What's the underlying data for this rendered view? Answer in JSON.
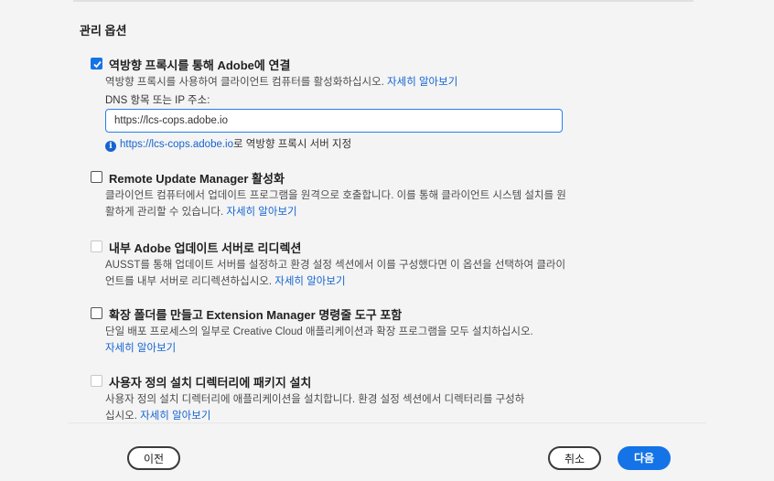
{
  "section_title": "관리 옵션",
  "options": [
    {
      "title": "역방향 프록시를 통해 Adobe에 연결",
      "checked": true,
      "disabled": false,
      "description": "역방향 프록시를 사용하여 클라이언트 컴퓨터를 활성화하십시오. ",
      "link": "자세히 알아보기"
    },
    {
      "title": "Remote Update Manager 활성화",
      "checked": false,
      "disabled": false,
      "description": "클라이언트 컴퓨터에서 업데이트 프로그램을 원격으로 호출합니다. 이를 통해 클라이언트 시스템 설치를 원활하게 관리할 수 있습니다. ",
      "link": "자세히 알아보기"
    },
    {
      "title": "내부 Adobe 업데이트 서버로 리디렉션",
      "checked": false,
      "disabled": true,
      "description": "AUSST를 통해 업데이트 서버를 설정하고 환경 설정 섹션에서 이를 구성했다면 이 옵션을 선택하여 클라이언트를 내부 서버로 리디렉션하십시오. ",
      "link": "자세히 알아보기"
    },
    {
      "title": "확장 폴더를 만들고 Extension Manager 명령줄 도구 포함",
      "checked": false,
      "disabled": false,
      "description": "단일 배포 프로세스의 일부로 Creative Cloud 애플리케이션과 확장 프로그램을 모두 설치하십시오.",
      "link": "자세히 알아보기"
    },
    {
      "title": "사용자 정의 설치 디렉터리에 패키지 설치",
      "checked": false,
      "disabled": true,
      "description": "사용자 정의 설치 디렉터리에 애플리케이션을 설치합니다. 환경 설정 섹션에서 디렉터리를 구성하십시오. ",
      "link": "자세히 알아보기"
    }
  ],
  "dns": {
    "label": "DNS 항목 또는 IP 주소:",
    "value": "https://lcs-cops.adobe.io",
    "info_link": "https://lcs-cops.adobe.io",
    "info_suffix": "로 역방향 프록시 서버 지정"
  },
  "footer": {
    "back": "이전",
    "cancel": "취소",
    "next": "다음"
  },
  "colors": {
    "accent": "#1473e6",
    "link": "#1464d2",
    "background": "#f4f4f4"
  }
}
